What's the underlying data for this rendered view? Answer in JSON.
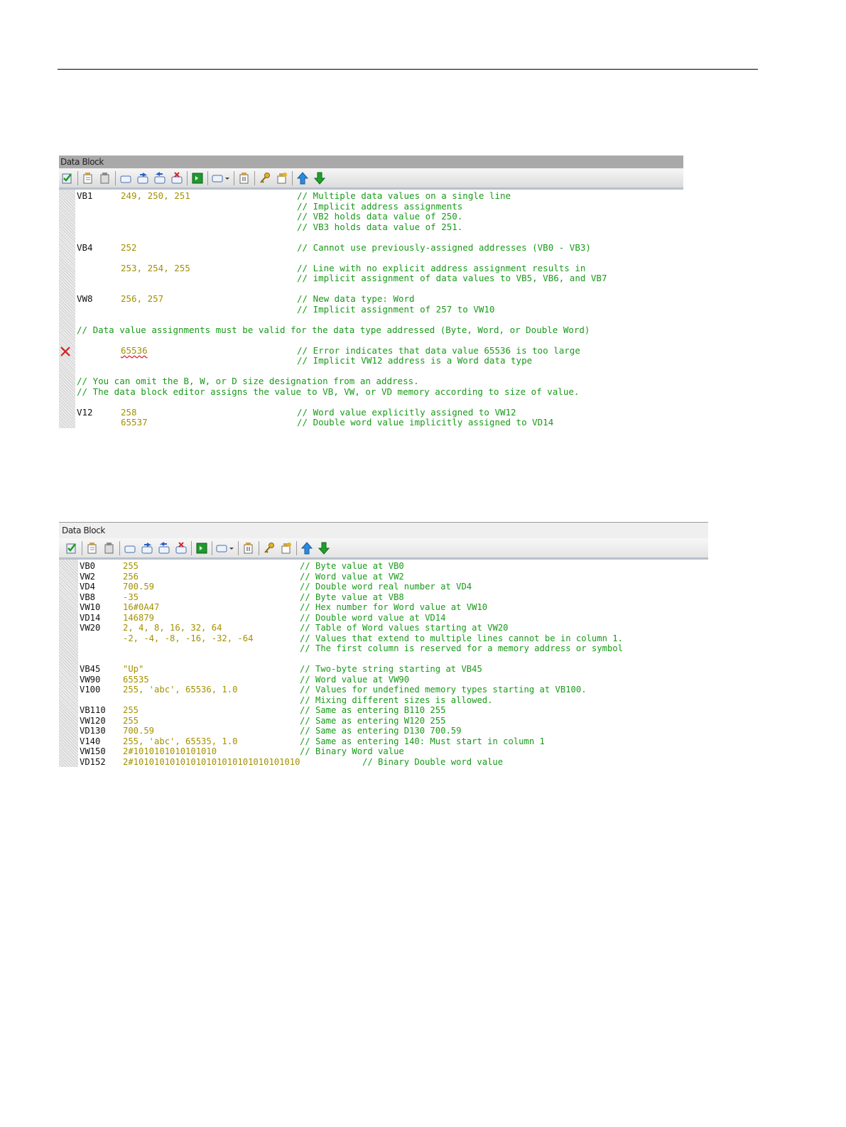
{
  "panel1": {
    "title": "Data Block",
    "rows": [
      {
        "addr": "VB1",
        "val": "249, 250, 251",
        "cmt": "// Multiple data values on a single line"
      },
      {
        "addr": "",
        "val": "",
        "cmt": "// Implicit address assignments"
      },
      {
        "addr": "",
        "val": "",
        "cmt": "// VB2 holds data value of 250."
      },
      {
        "addr": "",
        "val": "",
        "cmt": "// VB3 holds data value of 251."
      },
      {
        "addr": "",
        "val": "",
        "cmt": ""
      },
      {
        "addr": "VB4",
        "val": "252",
        "cmt": "// Cannot use previously-assigned addresses (VB0 - VB3)"
      },
      {
        "addr": "",
        "val": "",
        "cmt": ""
      },
      {
        "addr": "",
        "val": "253, 254, 255",
        "cmt": "// Line with no explicit address assignment results in"
      },
      {
        "addr": "",
        "val": "",
        "cmt": "// implicit assignment of data values to VB5, VB6, and VB7"
      },
      {
        "addr": "",
        "val": "",
        "cmt": ""
      },
      {
        "addr": "VW8",
        "val": "256, 257",
        "cmt": "// New data type: Word"
      },
      {
        "addr": "",
        "val": "",
        "cmt": "// Implicit assignment of 257 to VW10"
      },
      {
        "addr": "",
        "val": "",
        "cmt": ""
      },
      {
        "full": "// Data value assignments must be valid for the data type addressed (Byte, Word, or Double Word)"
      },
      {
        "addr": "",
        "val": "",
        "cmt": ""
      },
      {
        "addr": "",
        "val": "65536",
        "cmt": "// Error indicates that data value 65536 is too large",
        "error": true
      },
      {
        "addr": "",
        "val": "",
        "cmt": "// Implicit VW12 address is a Word data type"
      },
      {
        "addr": "",
        "val": "",
        "cmt": ""
      },
      {
        "full": "// You can omit the B, W, or D size designation from an address."
      },
      {
        "full": "// The data block editor assigns the value to VB, VW, or VD memory according to size of value."
      },
      {
        "addr": "",
        "val": "",
        "cmt": ""
      },
      {
        "addr": "V12",
        "val": "258",
        "cmt": "// Word value explicitly assigned to VW12"
      },
      {
        "addr": "",
        "val": "65537",
        "cmt": "// Double word value implicitly assigned to VD14"
      }
    ]
  },
  "panel2": {
    "title": "Data Block",
    "rows": [
      {
        "addr": "VB0",
        "val": "255",
        "cmt": "// Byte value at VB0"
      },
      {
        "addr": "VW2",
        "val": "256",
        "cmt": "// Word value at VW2"
      },
      {
        "addr": "VD4",
        "val": "700.59",
        "cmt": "// Double word real number at VD4"
      },
      {
        "addr": "VB8",
        "val": "-35",
        "cmt": "// Byte value at VB8"
      },
      {
        "addr": "VW10",
        "val": "16#0A47",
        "cmt": "// Hex number for Word value at VW10"
      },
      {
        "addr": "VD14",
        "val": "146879",
        "cmt": "// Double word value at VD14"
      },
      {
        "addr": "VW20",
        "val": "2, 4, 8, 16, 32, 64",
        "cmt": "// Table of Word values starting at VW20"
      },
      {
        "addr": "",
        "val": "-2, -4, -8, -16, -32, -64",
        "cmt": "// Values that extend to multiple lines cannot be in column 1."
      },
      {
        "addr": "",
        "val": "",
        "cmt": "// The first column is reserved for a memory address or symbol"
      },
      {
        "addr": "",
        "val": "",
        "cmt": ""
      },
      {
        "addr": "VB45",
        "val": "\"Up\"",
        "cmt": "// Two-byte string starting at VB45"
      },
      {
        "addr": "VW90",
        "val": "65535",
        "cmt": "// Word value at VW90"
      },
      {
        "addr": "V100",
        "val": "255, 'abc', 65536, 1.0",
        "cmt": "// Values for undefined memory types starting at VB100."
      },
      {
        "addr": "",
        "val": "",
        "cmt": "// Mixing different sizes is allowed."
      },
      {
        "addr": "VB110",
        "val": "255",
        "cmt": "// Same as entering B110 255"
      },
      {
        "addr": "VW120",
        "val": "255",
        "cmt": "// Same as entering W120 255"
      },
      {
        "addr": "VD130",
        "val": "700.59",
        "cmt": "// Same as entering D130 700.59"
      },
      {
        "addr": "V140",
        "val": "255, 'abc', 65535, 1.0",
        "cmt": "// Same as entering 140: Must start in column 1"
      },
      {
        "addr": "VW150",
        "val": "2#1010101010101010",
        "cmt": "// Binary Word value"
      },
      {
        "addr": "VD152",
        "val": "2#10101010101010101010101010101010",
        "cmt": "// Binary Double word value",
        "inline": true
      }
    ]
  },
  "toolbar": {
    "icons": [
      "check-icon",
      "insert-icon",
      "delete-icon",
      "blank-icon",
      "undo-icon",
      "redo-icon",
      "clear-icon",
      "go-icon",
      "dropdown-icon",
      "export-icon",
      "key-icon",
      "symbol-icon",
      "up-arrow-icon",
      "down-arrow-icon"
    ]
  },
  "colors": {
    "address": "#111111",
    "value": "#a39000",
    "comment": "#189a18",
    "error": "#d22222"
  }
}
